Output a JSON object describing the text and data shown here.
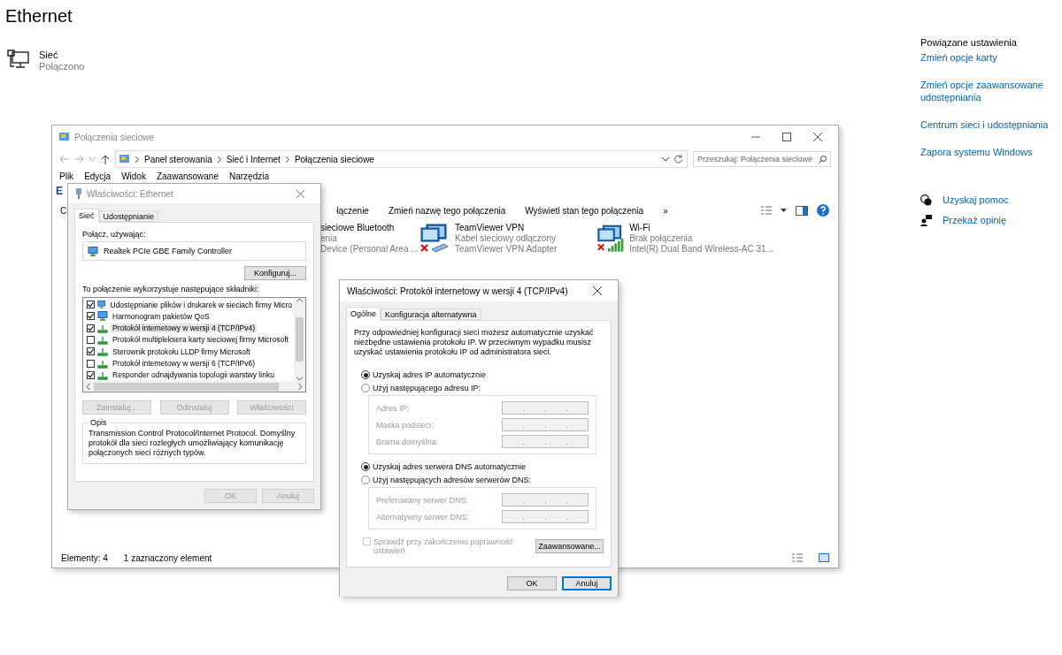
{
  "page": {
    "title": "Ethernet",
    "network": {
      "name": "Sieć",
      "status": "Połączono"
    }
  },
  "related": {
    "heading": "Powiązane ustawienia",
    "links": [
      "Zmień opcje karty",
      "Zmień opcje zaawansowane udostępniania",
      "Centrum sieci i udostępniania",
      "Zapora systemu Windows"
    ],
    "help": [
      {
        "kind": "help",
        "label": "Uzyskaj pomoc"
      },
      {
        "kind": "feedback",
        "label": "Przekaż opinię"
      }
    ]
  },
  "explorer": {
    "title": "Połączenia sieciowe",
    "breadcrumb": [
      "Panel sterowania",
      "Sieć i Internet",
      "Połączenia sieciowe"
    ],
    "search": {
      "placeholder": "Przeszukaj: Połączenia sieciowe"
    },
    "menu": [
      "Plik",
      "Edycja",
      "Widok",
      "Zaawansowane",
      "Narzędzia"
    ],
    "heading": "E",
    "toolbar_left": [
      "C"
    ],
    "toolbar": [
      "łączenie",
      "Zmień nazwę tego połączenia",
      "Wyświetl stan tego połączenia",
      "»"
    ],
    "items": [
      {
        "kind": "partial",
        "lines": [
          "sieciowe Bluetooth",
          "enia",
          "Device (Personal Area ..."
        ]
      },
      {
        "kind": "vpn",
        "lines": [
          "TeamViewer VPN",
          "Kabel sieciowy odłączony",
          "TeamViewer VPN Adapter"
        ]
      },
      {
        "kind": "wifi",
        "lines": [
          "Wi-Fi",
          "Brak połączenia",
          "Intel(R) Dual Band Wireless-AC 31..."
        ]
      }
    ],
    "status": [
      "Elementy: 4",
      "1 zaznaczony element"
    ]
  },
  "ethernet_dialog": {
    "title": "Właściwości: Ethernet",
    "tabs": [
      {
        "label": "Sieć",
        "selected": true
      },
      {
        "label": "Udostępnianie",
        "selected": false
      }
    ],
    "connect_label": "Połącz, używając:",
    "adapter": "Realtek PCIe GBE Family Controller",
    "configure": "Konfiguruj...",
    "components_label": "To połączenie wykorzystuje następujące składniki:",
    "components": [
      {
        "kind": "service",
        "label": "Udostępnianie plików i drukarek w sieciach firmy Micro",
        "checked": true,
        "selected": false
      },
      {
        "kind": "service",
        "label": "Harmonogram pakietów QoS",
        "checked": true,
        "selected": false
      },
      {
        "kind": "protocol",
        "label": "Protokół internetowy w wersji 4 (TCP/IPv4)",
        "checked": true,
        "selected": true
      },
      {
        "kind": "protocol",
        "label": "Protokół multipleksera karty sieciowej firmy Microsoft",
        "checked": false,
        "selected": false
      },
      {
        "kind": "protocol",
        "label": "Sterownik protokołu LLDP firmy Microsoft",
        "checked": true,
        "selected": false
      },
      {
        "kind": "protocol",
        "label": "Protokół internetowy w wersji 6 (TCP/IPv6)",
        "checked": false,
        "selected": false
      },
      {
        "kind": "protocol",
        "label": "Responder odnajdywania topologii warstwy linku",
        "checked": true,
        "selected": false
      }
    ],
    "actions": [
      {
        "label": "Zainstaluj...",
        "disabled": true
      },
      {
        "label": "Odinstaluj",
        "disabled": true
      },
      {
        "label": "Właściwości",
        "disabled": true
      }
    ],
    "description": {
      "title": "Opis",
      "text": "Transmission Control Protocol/Internet Protocol. Domyślny protokół dla sieci rozległych umożliwiający komunikację połączonych sieci różnych typów."
    },
    "buttons": [
      {
        "label": "OK",
        "disabled": true
      },
      {
        "label": "Anuluj",
        "disabled": true
      }
    ]
  },
  "ipv4_dialog": {
    "title": "Właściwości: Protokół internetowy w wersji 4 (TCP/IPv4)",
    "tabs": [
      {
        "label": "Ogólne",
        "selected": true
      },
      {
        "label": "Konfiguracja alternatywna",
        "selected": false
      }
    ],
    "intro": "Przy odpowiedniej konfiguracji sieci możesz automatycznie uzyskać niezbędne ustawienia protokołu IP. W przeciwnym wypadku musisz uzyskać ustawienia protokołu IP od administratora sieci.",
    "sections": [
      {
        "options": [
          {
            "label": "Uzyskaj adres IP automatycznie",
            "selected": true
          },
          {
            "label": "Użyj następującego adresu IP:",
            "selected": false
          }
        ],
        "fields": [
          {
            "label": "Adres IP:",
            "disabled": true
          },
          {
            "label": "Maska podsieci:",
            "disabled": true
          },
          {
            "label": "Brama domyślna:",
            "disabled": true
          }
        ]
      },
      {
        "options": [
          {
            "label": "Uzyskaj adres serwera DNS automatycznie",
            "selected": true
          },
          {
            "label": "Użyj następujących adresów serwerów DNS:",
            "selected": false
          }
        ],
        "fields": [
          {
            "label": "Preferowany serwer DNS:",
            "disabled": true
          },
          {
            "label": "Alternatywny serwer DNS:",
            "disabled": true
          }
        ]
      }
    ],
    "validate": {
      "label": "Sprawdź przy zakończeniu poprawność ustawień",
      "checked": false,
      "disabled": true
    },
    "advanced": "Zaawansowane...",
    "buttons": [
      {
        "label": "OK",
        "focused": false
      },
      {
        "label": "Anuluj",
        "focused": true
      }
    ]
  }
}
